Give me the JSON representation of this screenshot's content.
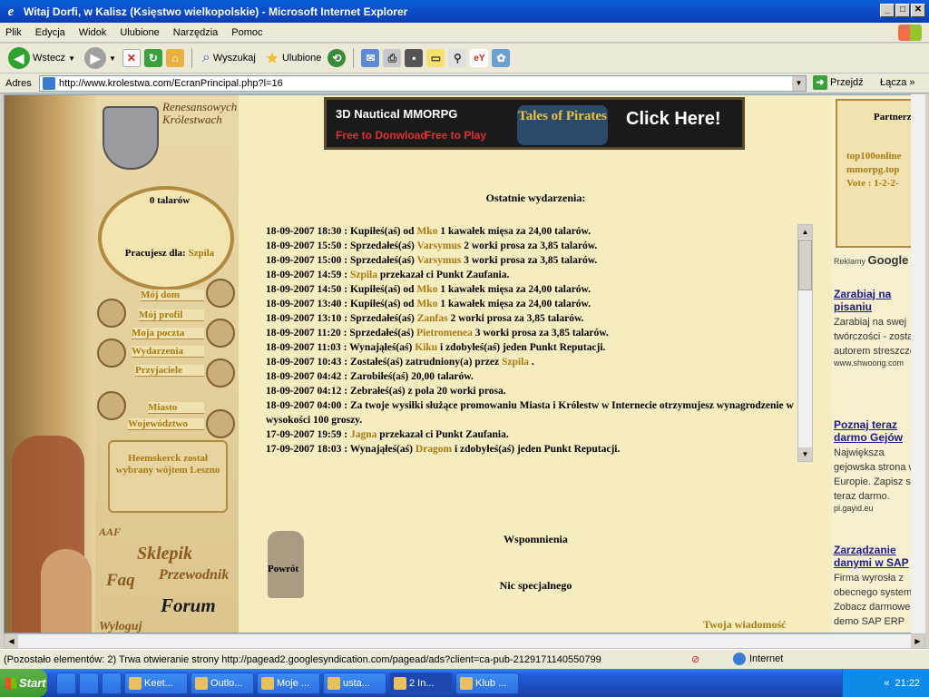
{
  "window": {
    "title": "Witaj Dorfi, w Kalisz (Księstwo wielkopolskie) - Microsoft Internet Explorer",
    "buttons": [
      "_",
      "□",
      "✕"
    ]
  },
  "menu": [
    "Plik",
    "Edycja",
    "Widok",
    "Ulubione",
    "Narzędzia",
    "Pomoc"
  ],
  "toolbar": {
    "back": "Wstecz",
    "search": "Wyszukaj",
    "favorites": "Ulubione"
  },
  "address": {
    "label": "Adres",
    "url": "http://www.krolestwa.com/EcranPrincipal.php?l=16",
    "go": "Przejdź",
    "links": "Łącza"
  },
  "banner": {
    "line1": "3D Nautical MMORPG",
    "line2a": "Free to Donwload",
    "line2b": "Free to Play",
    "logo": "Tales of Pirates",
    "cta": "Click Here!"
  },
  "left": {
    "logo_text": [
      "Renesansowych",
      "Królestwach"
    ],
    "talary": "0 talarów",
    "pracujesz_label": "Pracujesz dla:",
    "pracujesz_name": "Szpila",
    "nav": [
      "Mój dom",
      "Mój profil",
      "Moja poczta",
      "Wydarzenia",
      "Przyjaciele",
      "Miasto",
      "Województwo"
    ],
    "news": "Heemskerck został wybrany wójtem Leszno",
    "sklepik": "Sklepik",
    "faq": "Faq",
    "przewodnik": "Przewodnik",
    "forum": "Forum",
    "wyloguj": "Wyloguj",
    "aaf": "AAF"
  },
  "center": {
    "events_title": "Ostatnie wydarzenia:",
    "events": [
      {
        "pre": "18-09-2007 18:30 : Kupiłeś(aś) od ",
        "who": "Mko",
        "post": " 1 kawałek mięsa za 24,00 talarów."
      },
      {
        "pre": "18-09-2007 15:50 : Sprzedałeś(aś) ",
        "who": "Varsymus",
        "post": " 2 worki prosa za 3,85 talarów."
      },
      {
        "pre": "18-09-2007 15:00 : Sprzedałeś(aś) ",
        "who": "Varsymus",
        "post": " 3 worki prosa za 3,85 talarów."
      },
      {
        "pre": "18-09-2007 14:59 : ",
        "who": "Szpila",
        "post": " przekazał ci Punkt Zaufania."
      },
      {
        "pre": "18-09-2007 14:50 : Kupiłeś(aś) od ",
        "who": "Mko",
        "post": " 1 kawałek mięsa za 24,00 talarów."
      },
      {
        "pre": "18-09-2007 13:40 : Kupiłeś(aś) od ",
        "who": "Mko",
        "post": " 1 kawałek mięsa za 24,00 talarów."
      },
      {
        "pre": "18-09-2007 13:10 : Sprzedałeś(aś) ",
        "who": "Zanfas",
        "post": " 2 worki prosa za 3,85 talarów."
      },
      {
        "pre": "18-09-2007 11:20 : Sprzedałeś(aś) ",
        "who": "Pietromenea",
        "post": " 3 worki prosa za 3,85 talarów."
      },
      {
        "pre": "18-09-2007 11:03 : Wynająłeś(aś) ",
        "who": "Kiku",
        "post": " i zdobyłeś(aś) jeden Punkt Reputacji."
      },
      {
        "pre": "18-09-2007 10:43 : Zostałeś(aś) zatrudniony(a) przez ",
        "who": "Szpila",
        "post": " ."
      },
      {
        "pre": "18-09-2007 04:42 : Zarobiłeś(aś) 20,00 talarów.",
        "who": "",
        "post": ""
      },
      {
        "pre": "18-09-2007 04:12 : Zebrałeś(aś) z pola 20 worki prosa.",
        "who": "",
        "post": ""
      },
      {
        "pre": "18-09-2007 04:00 : Za twoje wysiłki służące promowaniu Miasta i Królestw w Internecie otrzymujesz wynagrodzenie w wysokości 100 groszy.",
        "who": "",
        "post": ""
      },
      {
        "pre": "17-09-2007 19:59 : ",
        "who": "Jagna",
        "post": " przekazał ci Punkt Zaufania."
      },
      {
        "pre": "17-09-2007 18:03 : Wynająłeś(aś) ",
        "who": "Dragom",
        "post": " i zdobyłeś(aś) jeden Punkt Reputacji."
      }
    ],
    "wspomnienia": "Wspomnienia",
    "nic": "Nic specjalnego",
    "powrot": "Powrót",
    "twoja": "Twoja wiadomość"
  },
  "right": {
    "partner_title": "Partnerzy",
    "partner_lines": [
      "top100online",
      "mmorpg.top",
      "Vote : 1-2-2-"
    ],
    "reklamy": "Reklamy",
    "google": "Google",
    "ads": [
      {
        "title": "Zarabiaj na pisaniu",
        "body": "Zarabiaj na swej twórczości - zostań autorem streszczeń",
        "url": "www.shwoong.com"
      },
      {
        "title": "Poznaj teraz darmo Gejów",
        "body": "Największa gejowska strona w Europie. Zapisz sie teraz darmo.",
        "url": "pl.gayid.eu"
      },
      {
        "title": "Zarządzanie danymi w SAP",
        "body": "Firma wyrosła z obecnego systemu? Zobacz darmowe demo SAP ERP",
        "url": ""
      }
    ]
  },
  "status": {
    "message": "(Pozostało elementów: 2) Trwa otwieranie strony http://pagead2.googlesyndication.com/pagead/ads?client=ca-pub-2129171140550799",
    "zone": "Internet"
  },
  "taskbar": {
    "start": "Start",
    "tasks": [
      "Keet...",
      "Outlo...",
      "Moje ...",
      "usta...",
      "2 In...",
      "Klub ..."
    ],
    "clock": "21:22"
  }
}
